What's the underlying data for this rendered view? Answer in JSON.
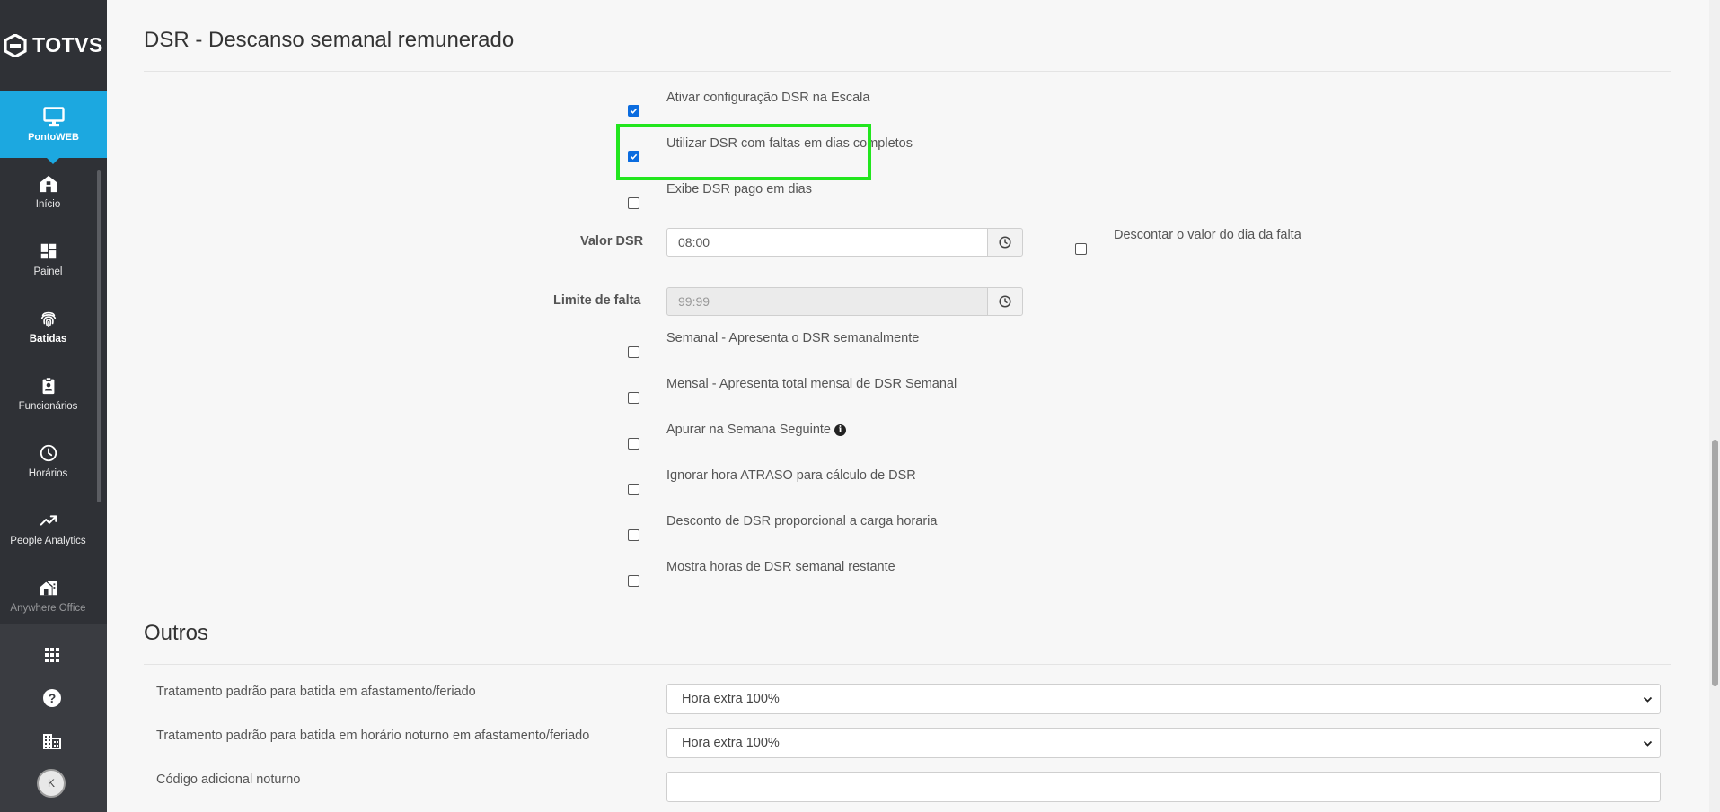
{
  "sidebar": {
    "brand": "TOTVS",
    "active_app": {
      "label": "PontoWEB",
      "icon": "monitor-icon"
    },
    "items": [
      {
        "label": "Início",
        "icon": "home-icon"
      },
      {
        "label": "Painel",
        "icon": "dashboard-icon"
      },
      {
        "label": "Batidas",
        "icon": "fingerprint-icon"
      },
      {
        "label": "Funcionários",
        "icon": "badge-icon"
      },
      {
        "label": "Horários",
        "icon": "clock-icon"
      },
      {
        "label": "People Analytics",
        "icon": "trending-up-icon"
      },
      {
        "label": "Anywhere Office",
        "icon": "home-work-icon"
      }
    ],
    "bottom_icons": [
      "apps-grid-icon",
      "help-icon",
      "building-icon"
    ],
    "avatar_initial": "K"
  },
  "dsr_section": {
    "title": "DSR - Descanso semanal remunerado",
    "options_top": [
      {
        "label": "Ativar configuração DSR na Escala",
        "checked": true
      },
      {
        "label": "Utilizar DSR com faltas em dias completos",
        "checked": true
      },
      {
        "label": "Exibe DSR pago em dias",
        "checked": false
      }
    ],
    "valor_dsr": {
      "label": "Valor DSR",
      "value": "08:00"
    },
    "descontar": {
      "label": "Descontar o valor do dia da falta",
      "checked": false
    },
    "limite_falta": {
      "label": "Limite de falta",
      "value": "99:99",
      "disabled": true
    },
    "options_bottom": [
      {
        "label": "Semanal - Apresenta o DSR semanalmente",
        "checked": false
      },
      {
        "label": "Mensal - Apresenta total mensal de DSR Semanal",
        "checked": false
      },
      {
        "label": "Apurar na Semana Seguinte",
        "checked": false,
        "info_icon": true
      },
      {
        "label": "Ignorar hora ATRASO para cálculo de DSR",
        "checked": false
      },
      {
        "label": "Desconto de DSR proporcional a carga horaria",
        "checked": false
      },
      {
        "label": "Mostra horas de DSR semanal restante",
        "checked": false
      }
    ]
  },
  "outros_section": {
    "title": "Outros",
    "rows": [
      {
        "label": "Tratamento padrão para batida em afastamento/feriado",
        "type": "select",
        "value": "Hora extra 100%"
      },
      {
        "label": "Tratamento padrão para batida em horário noturno em afastamento/feriado",
        "type": "select",
        "value": "Hora extra 100%"
      },
      {
        "label": "Código adicional noturno",
        "type": "text",
        "value": ""
      }
    ]
  },
  "colors": {
    "sidebar_bg": "#2f3136",
    "active_app_bg": "#1ca8e0",
    "checkbox_checked": "#0b6cdf",
    "highlight_border": "#22e61e"
  }
}
